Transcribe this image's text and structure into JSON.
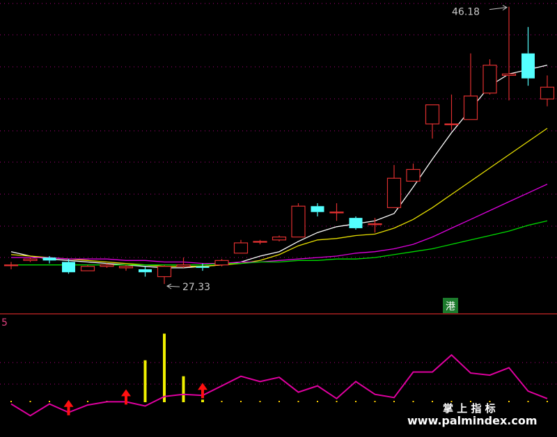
{
  "chart_data": [
    {
      "type": "candlestick",
      "annotations": {
        "high_label": "46.18",
        "low_label": "27.33",
        "badge": "港"
      },
      "ylim": [
        26.5,
        46.4
      ],
      "colors": {
        "up": "#e03030",
        "down": "#54ffff",
        "ma5": "#ffffff",
        "ma10": "#e8e000",
        "ma20": "#e000e0",
        "ma60": "#00dd00",
        "grid": "#b00080"
      },
      "x": [
        1,
        2,
        3,
        4,
        5,
        6,
        7,
        8,
        9,
        10,
        11,
        12,
        13,
        14,
        15,
        16,
        17,
        18,
        19,
        20,
        21,
        22,
        23,
        24,
        25,
        26,
        27,
        28,
        29
      ],
      "candles": [
        {
          "o": 28.6,
          "c": 28.6,
          "h": 28.8,
          "l": 28.3
        },
        {
          "o": 28.9,
          "c": 29.0,
          "h": 29.1,
          "l": 28.8
        },
        {
          "o": 29.1,
          "c": 28.9,
          "h": 29.2,
          "l": 28.7
        },
        {
          "o": 28.8,
          "c": 28.1,
          "h": 29.0,
          "l": 28.0
        },
        {
          "o": 28.2,
          "c": 28.5,
          "h": 28.6,
          "l": 28.2
        },
        {
          "o": 28.5,
          "c": 28.6,
          "h": 28.7,
          "l": 28.4
        },
        {
          "o": 28.4,
          "c": 28.5,
          "h": 28.6,
          "l": 28.2
        },
        {
          "o": 28.3,
          "c": 28.1,
          "h": 28.5,
          "l": 27.8
        },
        {
          "o": 27.8,
          "c": 28.5,
          "h": 28.6,
          "l": 27.3
        },
        {
          "o": 28.5,
          "c": 28.6,
          "h": 29.1,
          "l": 28.4
        },
        {
          "o": 28.5,
          "c": 28.4,
          "h": 28.7,
          "l": 28.2
        },
        {
          "o": 28.6,
          "c": 28.9,
          "h": 29.0,
          "l": 28.5
        },
        {
          "o": 29.4,
          "c": 30.1,
          "h": 30.3,
          "l": 29.4
        },
        {
          "o": 30.2,
          "c": 30.2,
          "h": 30.3,
          "l": 30.0
        },
        {
          "o": 30.3,
          "c": 30.5,
          "h": 30.6,
          "l": 30.2
        },
        {
          "o": 30.5,
          "c": 32.6,
          "h": 32.8,
          "l": 30.5
        },
        {
          "o": 32.6,
          "c": 32.2,
          "h": 32.8,
          "l": 31.9
        },
        {
          "o": 32.2,
          "c": 32.2,
          "h": 32.8,
          "l": 31.6
        },
        {
          "o": 31.8,
          "c": 31.1,
          "h": 31.9,
          "l": 31.0
        },
        {
          "o": 31.4,
          "c": 31.4,
          "h": 31.8,
          "l": 30.8
        },
        {
          "o": 32.5,
          "c": 34.5,
          "h": 35.4,
          "l": 32.5
        },
        {
          "o": 34.3,
          "c": 35.1,
          "h": 35.5,
          "l": 34.3
        },
        {
          "o": 38.2,
          "c": 39.5,
          "h": 39.5,
          "l": 37.2
        },
        {
          "o": 38.2,
          "c": 38.2,
          "h": 40.2,
          "l": 37.8
        },
        {
          "o": 38.5,
          "c": 40.1,
          "h": 43.0,
          "l": 38.5
        },
        {
          "o": 40.3,
          "c": 42.2,
          "h": 42.6,
          "l": 40.2
        },
        {
          "o": 41.5,
          "c": 41.6,
          "h": 46.18,
          "l": 39.8
        },
        {
          "o": 43.0,
          "c": 41.3,
          "h": 44.8,
          "l": 40.8
        },
        {
          "o": 39.9,
          "c": 40.7,
          "h": 41.5,
          "l": 39.4
        }
      ],
      "series": [
        {
          "name": "",
          "values": [
            29.5,
            29.2,
            29.0,
            28.9,
            28.8,
            28.7,
            28.6,
            28.5,
            28.4,
            28.4,
            28.5,
            28.6,
            28.8,
            29.2,
            29.5,
            30.2,
            30.8,
            31.2,
            31.4,
            31.6,
            32.1,
            33.9,
            35.8,
            37.6,
            39.2,
            40.8,
            41.6,
            41.9,
            42.2
          ]
        },
        {
          "name": "",
          "values": [
            29.3,
            29.2,
            29.1,
            29.0,
            28.9,
            28.8,
            28.7,
            28.6,
            28.5,
            28.5,
            28.5,
            28.6,
            28.7,
            28.9,
            29.3,
            29.9,
            30.3,
            30.4,
            30.6,
            30.7,
            31.1,
            31.7,
            32.5,
            33.4,
            34.3,
            35.2,
            36.1,
            37.0,
            37.9
          ]
        },
        {
          "name": "",
          "values": [
            29.1,
            29.1,
            29.1,
            29.0,
            29.0,
            29.0,
            28.9,
            28.9,
            28.8,
            28.8,
            28.7,
            28.7,
            28.8,
            28.8,
            28.9,
            29.0,
            29.1,
            29.2,
            29.4,
            29.5,
            29.7,
            30.0,
            30.5,
            31.1,
            31.7,
            32.3,
            32.9,
            33.5,
            34.1
          ]
        },
        {
          "name": "",
          "values": [
            28.6,
            28.6,
            28.6,
            28.6,
            28.6,
            28.6,
            28.6,
            28.6,
            28.6,
            28.6,
            28.6,
            28.7,
            28.7,
            28.8,
            28.8,
            28.9,
            28.9,
            29.0,
            29.0,
            29.1,
            29.3,
            29.5,
            29.7,
            30.0,
            30.3,
            30.6,
            30.9,
            31.3,
            31.6
          ]
        }
      ]
    },
    {
      "type": "indicator",
      "axis_label": "5",
      "ylim": [
        0,
        1
      ],
      "x": [
        1,
        2,
        3,
        4,
        5,
        6,
        7,
        8,
        9,
        10,
        11,
        12,
        13,
        14,
        15,
        16,
        17,
        18,
        19,
        20,
        21,
        22,
        23,
        24,
        25,
        26,
        27,
        28,
        29
      ],
      "line": {
        "name": "",
        "color": "#e000a0",
        "values": [
          0.18,
          0.07,
          0.18,
          0.1,
          0.17,
          0.2,
          0.2,
          0.16,
          0.25,
          0.27,
          0.26,
          0.35,
          0.44,
          0.39,
          0.43,
          0.29,
          0.35,
          0.23,
          0.39,
          0.27,
          0.24,
          0.48,
          0.48,
          0.64,
          0.47,
          0.45,
          0.52,
          0.3,
          0.23
        ]
      },
      "bars": {
        "name": "",
        "color": "#f0f000",
        "values": [
          0,
          0,
          0,
          0,
          0,
          0,
          0,
          0.59,
          0.84,
          0.44,
          0.22,
          0.11,
          0.05,
          0.03,
          0.02,
          0,
          0,
          0,
          0,
          0,
          0,
          0,
          0,
          0,
          0,
          0,
          0,
          0,
          0
        ]
      },
      "signals": {
        "color": "#ff1010",
        "x": [
          4,
          7,
          11
        ]
      },
      "baseline_dots": {
        "color": "#ffd000"
      }
    }
  ],
  "watermark": {
    "line1": "掌 上 指 标",
    "line2": "www.palmindex.com"
  }
}
